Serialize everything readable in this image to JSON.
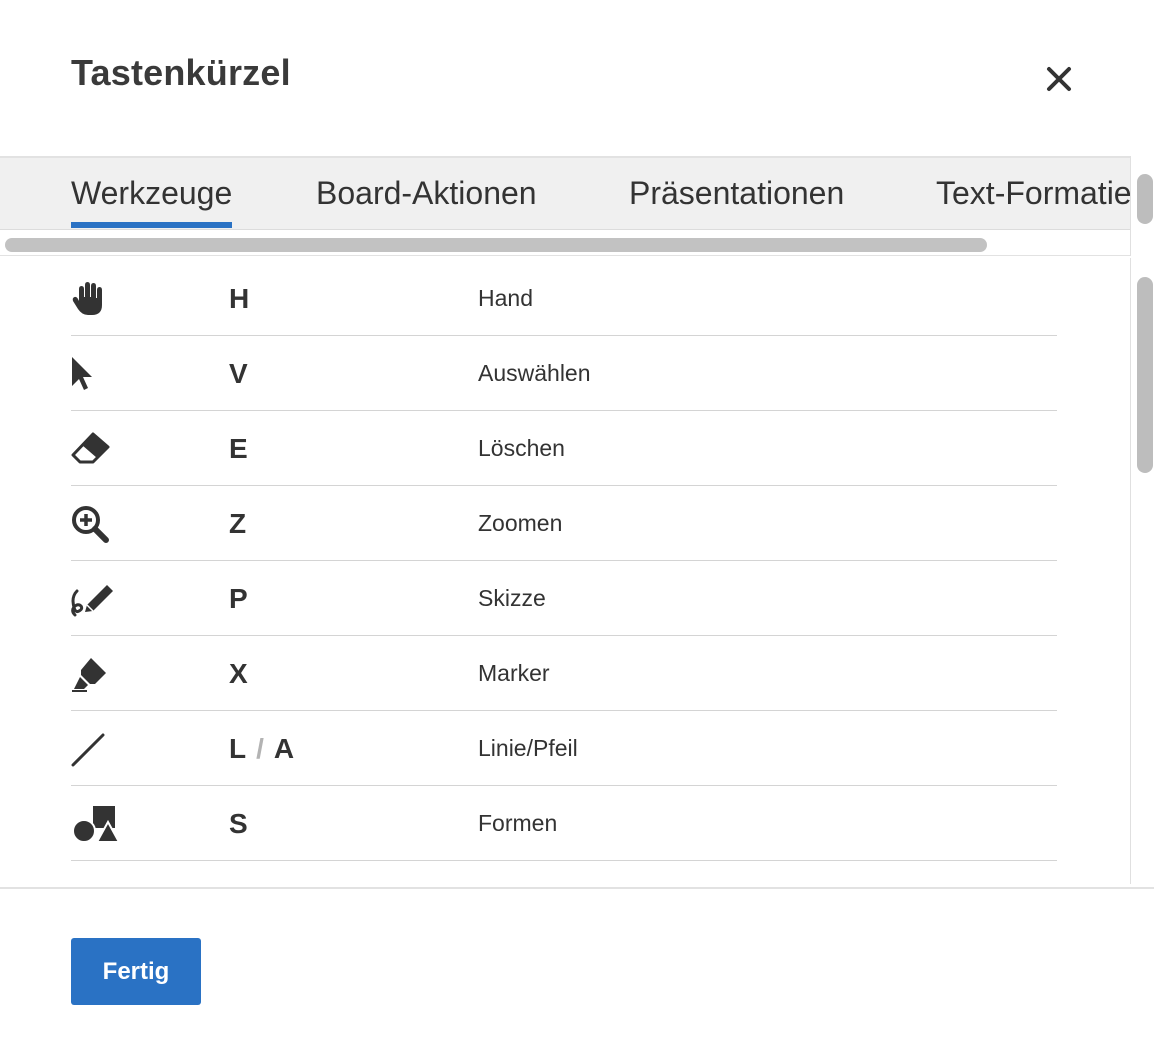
{
  "dialog": {
    "title": "Tastenkürzel",
    "close_icon": "close-icon"
  },
  "tabs": [
    {
      "label": "Werkzeuge",
      "active": true
    },
    {
      "label": "Board-Aktionen",
      "active": false
    },
    {
      "label": "Präsentationen",
      "active": false
    },
    {
      "label": "Text-Formatie",
      "active": false
    }
  ],
  "shortcuts": [
    {
      "icon": "hand-icon",
      "key": "H",
      "label": "Hand"
    },
    {
      "icon": "pointer-icon",
      "key": "V",
      "label": "Auswählen"
    },
    {
      "icon": "eraser-icon",
      "key": "E",
      "label": "Löschen"
    },
    {
      "icon": "zoom-in-icon",
      "key": "Z",
      "label": "Zoomen"
    },
    {
      "icon": "sketch-pen-icon",
      "key": "P",
      "label": "Skizze"
    },
    {
      "icon": "marker-icon",
      "key": "X",
      "label": "Marker"
    },
    {
      "icon": "line-icon",
      "key": "L",
      "key2": "A",
      "separator": "/",
      "label": "Linie/Pfeil"
    },
    {
      "icon": "shapes-icon",
      "key": "S",
      "label": "Formen"
    }
  ],
  "footer": {
    "done_label": "Fertig"
  },
  "colors": {
    "accent": "#2a72c4",
    "text": "#333333",
    "tab_strip": "#f0f0f0"
  }
}
